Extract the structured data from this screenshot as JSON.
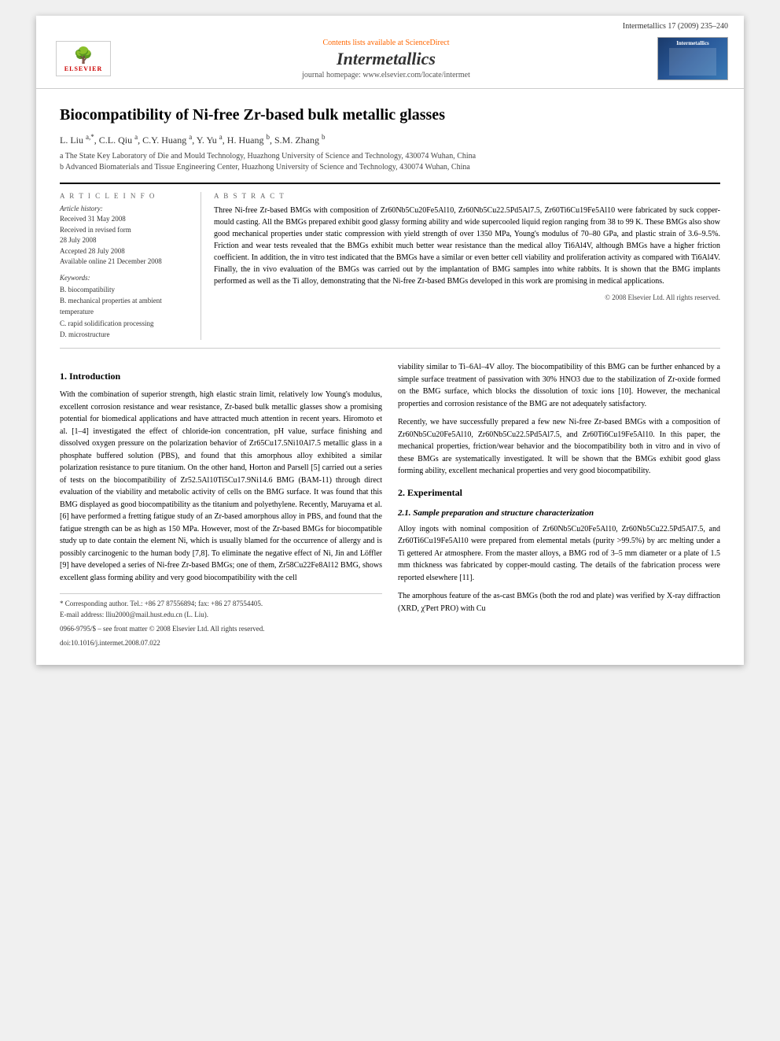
{
  "journal": {
    "meta_top": "Intermetallics 17 (2009) 235–240",
    "sciencedirect_prefix": "Contents lists available at ",
    "sciencedirect_link": "ScienceDirect",
    "title": "Intermetallics",
    "url": "journal homepage: www.elsevier.com/locate/intermet",
    "elsevier_label": "ELSEVIER",
    "intermetallics_logo_label": "Intermetallics"
  },
  "article": {
    "title": "Biocompatibility of Ni-free Zr-based bulk metallic glasses",
    "authors": "L. Liu a,*, C.L. Qiu a, C.Y. Huang a, Y. Yu a, H. Huang b, S.M. Zhang b",
    "affiliation_a": "a The State Key Laboratory of Die and Mould Technology, Huazhong University of Science and Technology, 430074 Wuhan, China",
    "affiliation_b": "b Advanced Biomaterials and Tissue Engineering Center, Huazhong University of Science and Technology, 430074 Wuhan, China"
  },
  "article_info": {
    "header": "A R T I C L E   I N F O",
    "history_label": "Article history:",
    "received": "Received 31 May 2008",
    "revised": "Received in revised form",
    "revised_date": "28 July 2008",
    "accepted": "Accepted 28 July 2008",
    "available": "Available online 21 December 2008",
    "keywords_header": "Keywords:",
    "keyword1": "B. biocompatibility",
    "keyword2": "B. mechanical properties at ambient",
    "keyword2b": "temperature",
    "keyword3": "C. rapid solidification processing",
    "keyword4": "D. microstructure"
  },
  "abstract": {
    "header": "A B S T R A C T",
    "text": "Three Ni-free Zr-based BMGs with composition of Zr60Nb5Cu20Fe5Al10, Zr60Nb5Cu22.5Pd5Al7.5, Zr60Ti6Cu19Fe5Al10 were fabricated by suck copper-mould casting. All the BMGs prepared exhibit good glassy forming ability and wide supercooled liquid region ranging from 38 to 99 K. These BMGs also show good mechanical properties under static compression with yield strength of over 1350 MPa, Young's modulus of 70–80 GPa, and plastic strain of 3.6–9.5%. Friction and wear tests revealed that the BMGs exhibit much better wear resistance than the medical alloy Ti6Al4V, although BMGs have a higher friction coefficient. In addition, the in vitro test indicated that the BMGs have a similar or even better cell viability and proliferation activity as compared with Ti6Al4V. Finally, the in vivo evaluation of the BMGs was carried out by the implantation of BMG samples into white rabbits. It is shown that the BMG implants performed as well as the Ti alloy, demonstrating that the Ni-free Zr-based BMGs developed in this work are promising in medical applications.",
    "copyright": "© 2008 Elsevier Ltd. All rights reserved."
  },
  "section1": {
    "title": "1.  Introduction",
    "paragraph1": "With the combination of superior strength, high elastic strain limit, relatively low Young's modulus, excellent corrosion resistance and wear resistance, Zr-based bulk metallic glasses show a promising potential for biomedical applications and have attracted much attention in recent years. Hiromoto et al. [1–4] investigated the effect of chloride-ion concentration, pH value, surface finishing and dissolved oxygen pressure on the polarization behavior of Zr65Cu17.5Ni10Al7.5 metallic glass in a phosphate buffered solution (PBS), and found that this amorphous alloy exhibited a similar polarization resistance to pure titanium. On the other hand, Horton and Parsell [5] carried out a series of tests on the biocompatibility of Zr52.5Al10Ti5Cu17.9Ni14.6 BMG (BAM-11) through direct evaluation of the viability and metabolic activity of cells on the BMG surface. It was found that this BMG displayed as good biocompatibility as the titanium and polyethylene. Recently, Maruyama et al. [6] have performed a fretting fatigue study of an Zr-based amorphous alloy in PBS, and found that the fatigue strength can be as high as 150 MPa. However, most of the Zr-based BMGs for biocompatible study up to date contain the element Ni, which is usually blamed for the occurrence of allergy and is possibly carcinogenic to the human body [7,8]. To eliminate the negative effect of Ni, Jin and Löffler [9] have developed a series of Ni-free Zr-based BMGs; one of them, Zr58Cu22Fe8Al12 BMG, shows excellent glass forming ability and very good biocompatibility with the cell",
    "footnote_corresponding": "* Corresponding author. Tel.: +86 27 87556894; fax: +86 27 87554405.",
    "footnote_email": "E-mail address: lliu2000@mail.hust.edu.cn (L. Liu).",
    "issn_line": "0966-9795/$ – see front matter © 2008 Elsevier Ltd. All rights reserved.",
    "doi_line": "doi:10.1016/j.intermet.2008.07.022"
  },
  "section1_col2": {
    "paragraph1": "viability similar to Ti–6Al–4V alloy. The biocompatibility of this BMG can be further enhanced by a simple surface treatment of passivation with 30% HNO3 due to the stabilization of Zr-oxide formed on the BMG surface, which blocks the dissolution of toxic ions [10]. However, the mechanical properties and corrosion resistance of the BMG are not adequately satisfactory.",
    "paragraph2": "Recently, we have successfully prepared a few new Ni-free Zr-based BMGs with a composition of Zr60Nb5Cu20Fe5Al10, Zr60Nb5Cu22.5Pd5Al7.5, and Zr60Ti6Cu19Fe5Al10. In this paper, the mechanical properties, friction/wear behavior and the biocompatibility both in vitro and in vivo of these BMGs are systematically investigated. It will be shown that the BMGs exhibit good glass forming ability, excellent mechanical properties and very good biocompatibility."
  },
  "section2": {
    "title": "2.  Experimental",
    "subsection_title": "2.1.  Sample preparation and structure characterization",
    "paragraph1": "Alloy ingots with nominal composition of Zr60Nb5Cu20Fe5Al10, Zr60Nb5Cu22.5Pd5Al7.5, and Zr60Ti6Cu19Fe5Al10 were prepared from elemental metals (purity >99.5%) by arc melting under a Ti gettered Ar atmosphere. From the master alloys, a BMG rod of 3–5 mm diameter or a plate of 1.5 mm thickness was fabricated by copper-mould casting. The details of the fabrication process were reported elsewhere [11].",
    "paragraph2": "The amorphous feature of the as-cast BMGs (both the rod and plate) was verified by X-ray diffraction (XRD, χ'Pert PRO) with Cu"
  }
}
